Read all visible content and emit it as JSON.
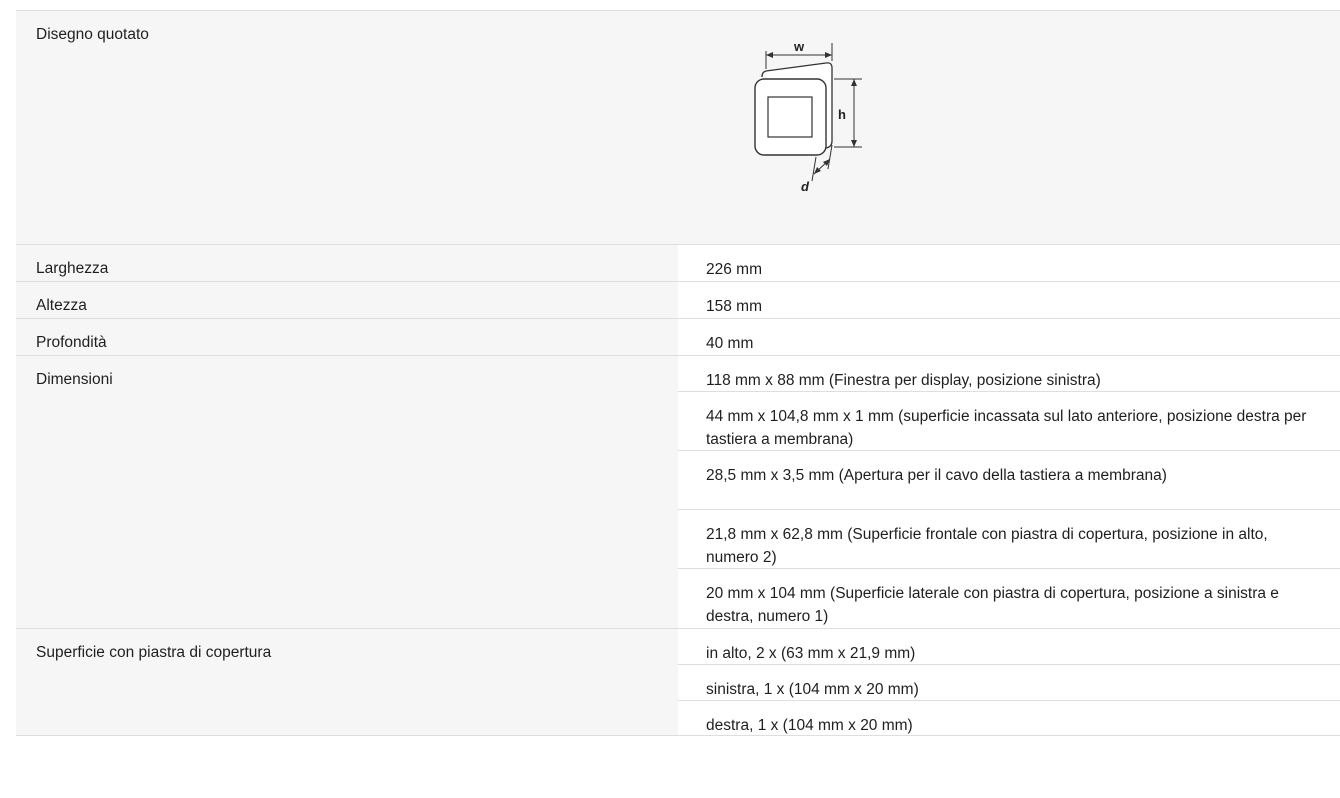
{
  "drawing": {
    "label": "Disegno quotato",
    "dim_w": "w",
    "dim_h": "h",
    "dim_d": "d"
  },
  "rows": [
    {
      "label": "Larghezza",
      "value": "226 mm"
    },
    {
      "label": "Altezza",
      "value": "158 mm"
    },
    {
      "label": "Profondità",
      "value": "40 mm"
    }
  ],
  "dimensioni": {
    "label": "Dimensioni",
    "values": [
      "118 mm x 88 mm (Finestra per display, posizione sinistra)",
      "44 mm x 104,8 mm x 1 mm (superficie incassata sul lato anteriore, posizione destra per tastiera a membrana)",
      "28,5 mm x 3,5 mm (Apertura per il cavo della tastiera a membrana)",
      "21,8 mm x 62,8 mm (Superficie frontale con piastra di copertura, posizione in alto, numero 2)",
      "20 mm x 104 mm (Superficie laterale con piastra di copertura, posizione a sinistra e destra, numero 1)"
    ]
  },
  "superficie": {
    "label": "Superficie con piastra di copertura",
    "values": [
      "in alto, 2 x (63 mm x 21,9 mm)",
      "sinistra, 1 x (104 mm x 20 mm)",
      "destra, 1 x (104 mm x 20 mm)"
    ]
  }
}
